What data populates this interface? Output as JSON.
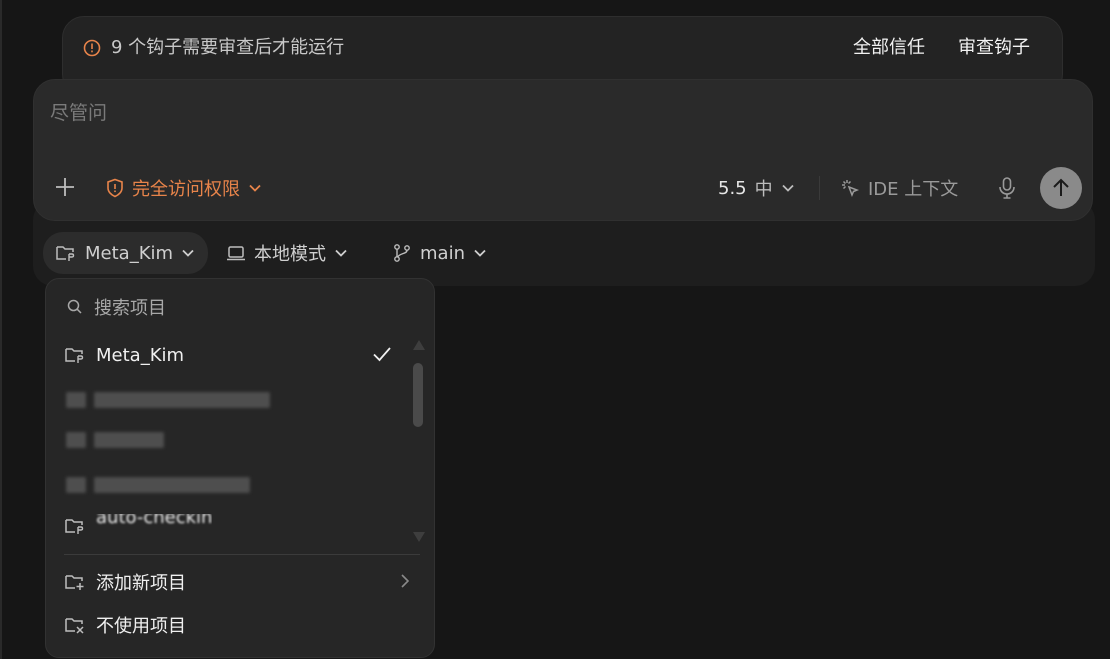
{
  "hook_banner": {
    "message": "9 个钩子需要审查后才能运行",
    "trust_all_label": "全部信任",
    "review_label": "审查钩子"
  },
  "composer": {
    "placeholder": "尽管问",
    "permission_label": "完全访问权限",
    "model_version": "5.5",
    "model_effort": "中",
    "ide_context_label": "IDE 上下文"
  },
  "context_bar": {
    "project_label": "Meta_Kim",
    "mode_label": "本地模式",
    "branch_label": "main"
  },
  "project_dropdown": {
    "search_placeholder": "搜索项目",
    "selected_project": "Meta_Kim",
    "partially_visible_project": "auto-checkin",
    "add_project_label": "添加新项目",
    "no_project_label": "不使用项目"
  },
  "colors": {
    "background": "#161616",
    "accent_orange": "#e8844a",
    "send_button": "#8a8a8a"
  }
}
